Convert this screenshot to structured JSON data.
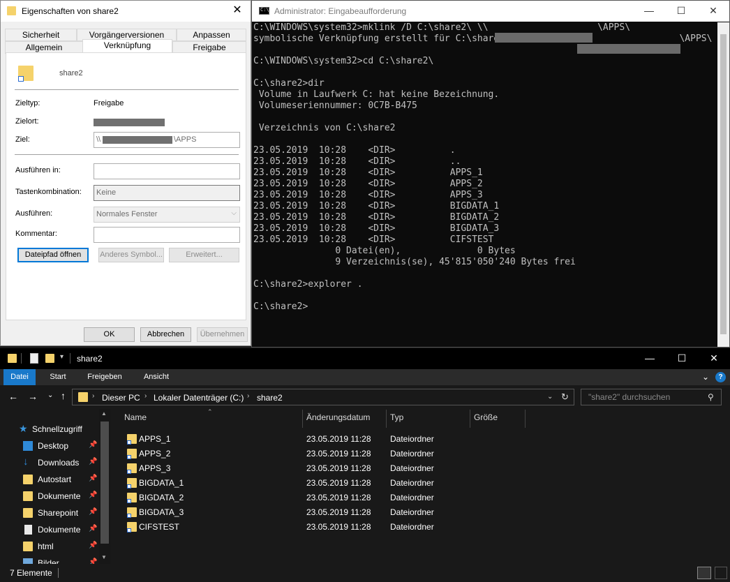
{
  "props": {
    "title": "Eigenschaften von share2",
    "tabs_row1": [
      "Sicherheit",
      "Vorgängerversionen",
      "Anpassen"
    ],
    "tabs_row2": [
      "Allgemein",
      "Verknüpfung",
      "Freigabe"
    ],
    "name": "share2",
    "zieltyp_label": "Zieltyp:",
    "zieltyp_value": "Freigabe",
    "zielort_label": "Zielort:",
    "ziel_label": "Ziel:",
    "ziel_prefix": "\\\\",
    "ziel_suffix": "\\APPS",
    "ausfuehren_in_label": "Ausführen in:",
    "tasten_label": "Tastenkombination:",
    "tasten_value": "Keine",
    "ausfuehren_label": "Ausführen:",
    "ausfuehren_value": "Normales Fenster",
    "kommentar_label": "Kommentar:",
    "btn_dateipfad": "Dateipfad öffnen",
    "btn_symbol": "Anderes Symbol...",
    "btn_erweitert": "Erweitert...",
    "btn_ok": "OK",
    "btn_abbrechen": "Abbrechen",
    "btn_uebernehmen": "Übernehmen"
  },
  "cmd": {
    "title": "Administrator: Eingabeaufforderung",
    "lines": [
      "C:\\WINDOWS\\system32>mklink /D C:\\share2\\ \\\\                    \\APPS\\",
      "symbolische Verknüpfung erstellt für C:\\share2\\ <<===>> \\\\                    \\APPS\\",
      "",
      "C:\\WINDOWS\\system32>cd C:\\share2\\",
      "",
      "C:\\share2>dir",
      " Volume in Laufwerk C: hat keine Bezeichnung.",
      " Volumeseriennummer: 0C7B-B475",
      "",
      " Verzeichnis von C:\\share2",
      "",
      "23.05.2019  10:28    <DIR>          .",
      "23.05.2019  10:28    <DIR>          ..",
      "23.05.2019  10:28    <DIR>          APPS_1",
      "23.05.2019  10:28    <DIR>          APPS_2",
      "23.05.2019  10:28    <DIR>          APPS_3",
      "23.05.2019  10:28    <DIR>          BIGDATA_1",
      "23.05.2019  10:28    <DIR>          BIGDATA_2",
      "23.05.2019  10:28    <DIR>          BIGDATA_3",
      "23.05.2019  10:28    <DIR>          CIFSTEST",
      "               0 Datei(en),              0 Bytes",
      "               9 Verzeichnis(se), 45'815'050'240 Bytes frei",
      "",
      "C:\\share2>explorer .",
      "",
      "C:\\share2>"
    ]
  },
  "explorer": {
    "title": "share2",
    "ribbon_tabs": [
      "Datei",
      "Start",
      "Freigeben",
      "Ansicht"
    ],
    "breadcrumb": [
      "Dieser PC",
      "Lokaler Datenträger (C:)",
      "share2"
    ],
    "search_placeholder": "\"share2\" durchsuchen",
    "columns": [
      "Name",
      "Änderungsdatum",
      "Typ",
      "Größe"
    ],
    "nav_items": [
      {
        "label": "Schnellzugriff",
        "icon": "star-icon"
      },
      {
        "label": "Desktop",
        "icon": "desktop-icon"
      },
      {
        "label": "Downloads",
        "icon": "download-icon"
      },
      {
        "label": "Autostart",
        "icon": "folder-icon"
      },
      {
        "label": "Dokumente",
        "icon": "folder-icon"
      },
      {
        "label": "Sharepoint",
        "icon": "folder-icon"
      },
      {
        "label": "Dokumente",
        "icon": "document-icon"
      },
      {
        "label": "html",
        "icon": "folder-icon"
      },
      {
        "label": "Bilder",
        "icon": "pictures-icon"
      }
    ],
    "files": [
      {
        "name": "APPS_1",
        "date": "23.05.2019 11:28",
        "type": "Dateiordner"
      },
      {
        "name": "APPS_2",
        "date": "23.05.2019 11:28",
        "type": "Dateiordner"
      },
      {
        "name": "APPS_3",
        "date": "23.05.2019 11:28",
        "type": "Dateiordner"
      },
      {
        "name": "BIGDATA_1",
        "date": "23.05.2019 11:28",
        "type": "Dateiordner"
      },
      {
        "name": "BIGDATA_2",
        "date": "23.05.2019 11:28",
        "type": "Dateiordner"
      },
      {
        "name": "BIGDATA_3",
        "date": "23.05.2019 11:28",
        "type": "Dateiordner"
      },
      {
        "name": "CIFSTEST",
        "date": "23.05.2019 11:28",
        "type": "Dateiordner"
      }
    ],
    "status": "7 Elemente"
  }
}
